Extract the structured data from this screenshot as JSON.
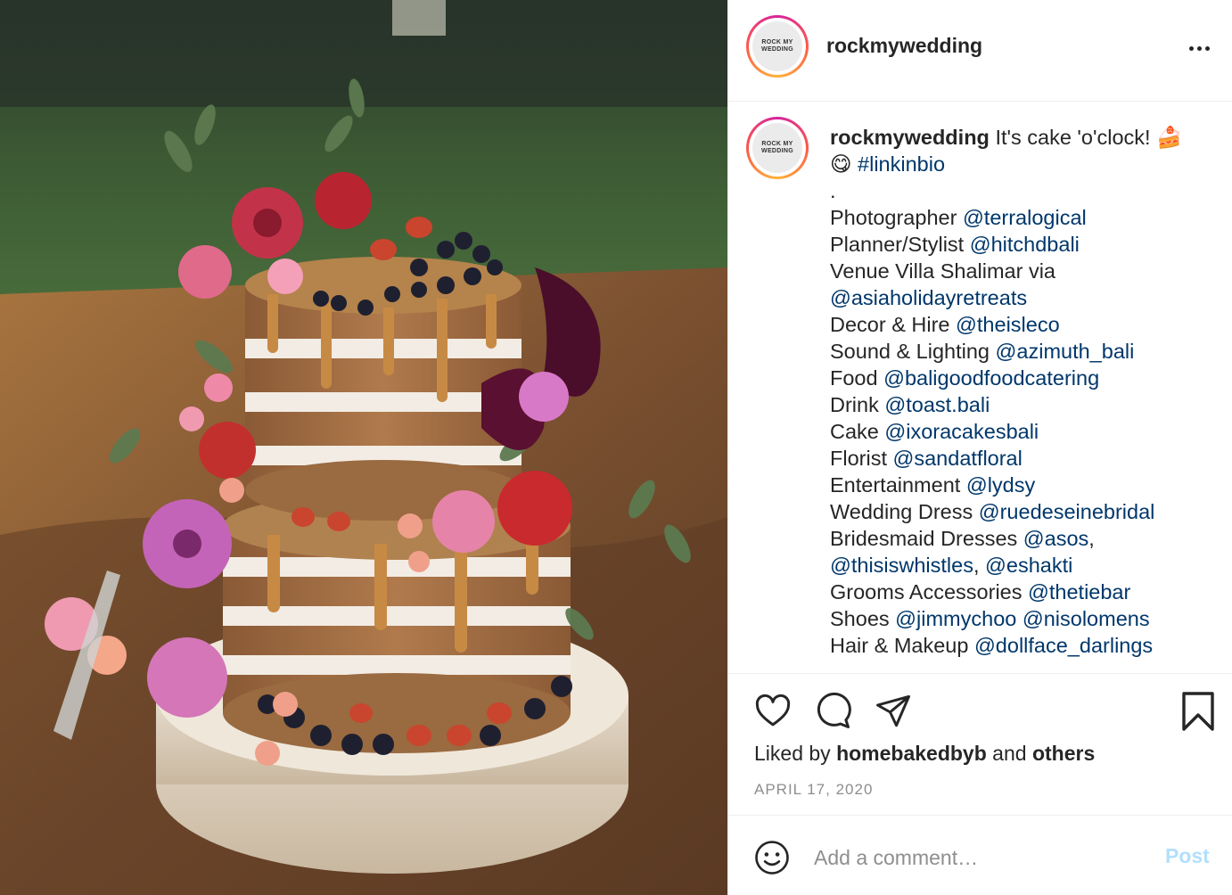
{
  "post": {
    "username": "rockmywedding",
    "avatar_text_line1": "ROCK MY",
    "avatar_text_line2": "WEDDING",
    "more_icon": "more-horizontal-icon"
  },
  "caption": {
    "username": "rockmywedding",
    "lines": [
      {
        "text": "It's cake 'o'clock! 🍰",
        "mention": ""
      },
      {
        "text": "😋 ",
        "mention": "#linkinbio"
      },
      {
        "text": ".",
        "mention": ""
      },
      {
        "text": "Photographer ",
        "mention": "@terralogical"
      },
      {
        "text": "Planner/Stylist ",
        "mention": "@hitchdbali"
      },
      {
        "text": "Venue Villa Shalimar via",
        "mention": ""
      },
      {
        "text": "",
        "mention": "@asiaholidayretreats"
      },
      {
        "text": "Decor & Hire ",
        "mention": "@theisleco"
      },
      {
        "text": "Sound & Lighting ",
        "mention": "@azimuth_bali"
      },
      {
        "text": "Food ",
        "mention": "@baligoodfoodcatering"
      },
      {
        "text": "Drink ",
        "mention": "@toast.bali"
      },
      {
        "text": "Cake ",
        "mention": "@ixoracakesbali"
      },
      {
        "text": "Florist ",
        "mention": "@sandatfloral"
      },
      {
        "text": "Entertainment ",
        "mention": "@lydsy"
      },
      {
        "text": "Wedding Dress ",
        "mention": "@ruedeseinebridal"
      },
      {
        "text": "Bridesmaid Dresses ",
        "mention": "@asos",
        "suffix": ","
      },
      {
        "text": "",
        "mention": "@thisiswhistles",
        "suffix": ", ",
        "mention2": "@eshakti"
      },
      {
        "text": "Grooms Accessories ",
        "mention": "@thetiebar"
      },
      {
        "text": "Shoes ",
        "mention": "@jimmychoo",
        "suffix": " ",
        "mention2": "@nisolomens"
      },
      {
        "text": "Hair & Makeup ",
        "mention": "@dollface_darlings"
      }
    ]
  },
  "actions": {
    "like_icon": "heart-icon",
    "comment_icon": "comment-icon",
    "share_icon": "share-icon",
    "save_icon": "bookmark-icon"
  },
  "likes": {
    "prefix": "Liked by ",
    "user": "homebakedbyb",
    "middle": " and ",
    "others": "others"
  },
  "date": "APRIL 17, 2020",
  "comment": {
    "placeholder": "Add a comment…",
    "post_label": "Post",
    "emoji_icon": "smiley-icon"
  },
  "colors": {
    "link": "#00376b",
    "muted": "#8e8e8e",
    "post_disabled": "#b2dffc"
  }
}
